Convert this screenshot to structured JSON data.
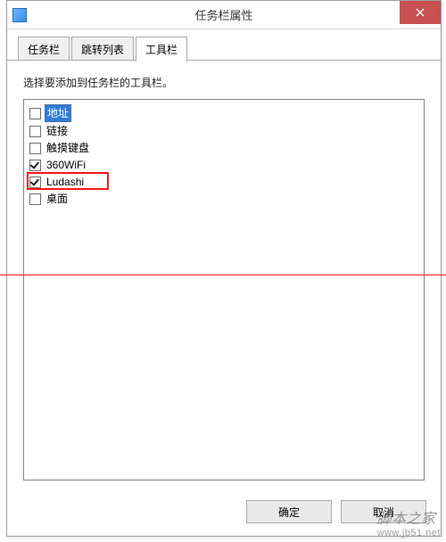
{
  "window": {
    "title": "任务栏属性"
  },
  "tabs": {
    "t0": "任务栏",
    "t1": "跳转列表",
    "t2": "工具栏"
  },
  "instruction": "选择要添加到任务栏的工具栏。",
  "items": {
    "i0": {
      "label": "地址",
      "checked": false,
      "selected": true
    },
    "i1": {
      "label": "链接",
      "checked": false
    },
    "i2": {
      "label": "触摸键盘",
      "checked": false
    },
    "i3": {
      "label": "360WiFi",
      "checked": true
    },
    "i4": {
      "label": "Ludashi",
      "checked": true,
      "highlighted": true
    },
    "i5": {
      "label": "桌面",
      "checked": false
    }
  },
  "buttons": {
    "ok": "确定",
    "cancel": "取消"
  },
  "watermark": {
    "line1": "脚本之家",
    "line2": "www.jb51.net"
  }
}
